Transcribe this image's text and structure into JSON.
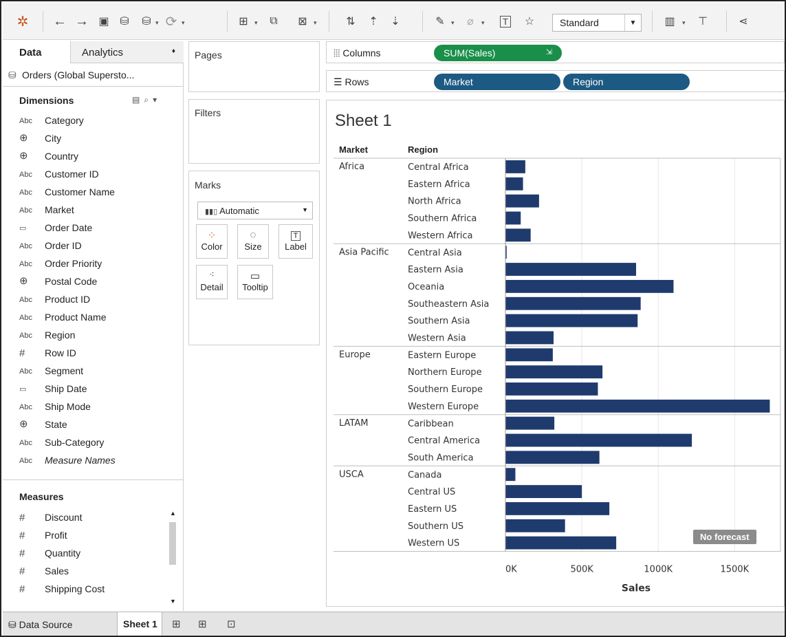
{
  "toolbar": {
    "icons": [
      "tableau-logo-icon",
      "back-icon",
      "forward-icon",
      "save-icon",
      "new-datasource-icon",
      "pause-updates-icon",
      "refresh-icon",
      "new-worksheet-icon",
      "duplicate-sheet-icon",
      "clear-sheet-icon",
      "swap-icon",
      "sort-asc-icon",
      "sort-desc-icon",
      "highlight-icon",
      "group-icon",
      "labels-icon",
      "pin-icon",
      "show-me-icon",
      "presentation-icon",
      "share-icon"
    ],
    "fit_value": "Standard"
  },
  "left": {
    "tabs": {
      "data": "Data",
      "analytics": "Analytics"
    },
    "datasource": "Orders (Global Supersto...",
    "dimensions_title": "Dimensions",
    "dimensions": [
      {
        "type": "Abc",
        "name": "Category"
      },
      {
        "type": "globe",
        "name": "City"
      },
      {
        "type": "globe",
        "name": "Country"
      },
      {
        "type": "Abc",
        "name": "Customer ID"
      },
      {
        "type": "Abc",
        "name": "Customer Name"
      },
      {
        "type": "Abc",
        "name": "Market"
      },
      {
        "type": "date",
        "name": "Order Date"
      },
      {
        "type": "Abc",
        "name": "Order ID"
      },
      {
        "type": "Abc",
        "name": "Order Priority"
      },
      {
        "type": "globe",
        "name": "Postal Code"
      },
      {
        "type": "Abc",
        "name": "Product ID"
      },
      {
        "type": "Abc",
        "name": "Product Name"
      },
      {
        "type": "Abc",
        "name": "Region"
      },
      {
        "type": "#",
        "name": "Row ID"
      },
      {
        "type": "Abc",
        "name": "Segment"
      },
      {
        "type": "date",
        "name": "Ship Date"
      },
      {
        "type": "Abc",
        "name": "Ship Mode"
      },
      {
        "type": "globe",
        "name": "State"
      },
      {
        "type": "Abc",
        "name": "Sub-Category"
      },
      {
        "type": "Abc",
        "name": "Measure Names",
        "italic": true
      }
    ],
    "measures_title": "Measures",
    "measures": [
      {
        "type": "#",
        "name": "Discount"
      },
      {
        "type": "#",
        "name": "Profit"
      },
      {
        "type": "#",
        "name": "Quantity"
      },
      {
        "type": "#",
        "name": "Sales"
      },
      {
        "type": "#",
        "name": "Shipping Cost"
      }
    ]
  },
  "cards": {
    "pages": "Pages",
    "filters": "Filters",
    "marks": "Marks",
    "mark_type": "Automatic",
    "mark_buttons": [
      "Color",
      "Size",
      "Label",
      "Detail",
      "Tooltip"
    ]
  },
  "shelves": {
    "columns_label": "Columns",
    "rows_label": "Rows",
    "columns_pills": [
      "SUM(Sales)"
    ],
    "rows_pills": [
      "Market",
      "Region"
    ]
  },
  "sheet": {
    "title": "Sheet 1",
    "market_header": "Market",
    "region_header": "Region",
    "no_forecast": "No forecast"
  },
  "chart_data": {
    "type": "bar",
    "orientation": "horizontal",
    "xlabel": "Sales",
    "xlim": [
      0,
      1800000
    ],
    "x_ticks": [
      "0K",
      "500K",
      "1000K",
      "1500K"
    ],
    "x_tick_values": [
      0,
      500000,
      1000000,
      1500000
    ],
    "bar_color": "#1f3b6e",
    "groups": [
      {
        "market": "Africa",
        "regions": [
          "Central Africa",
          "Eastern Africa",
          "North Africa",
          "Southern Africa",
          "Western Africa"
        ],
        "values": [
          130000,
          115000,
          220000,
          100000,
          165000
        ]
      },
      {
        "market": "Asia Pacific",
        "regions": [
          "Central Asia",
          "Eastern Asia",
          "Oceania",
          "Southeastern Asia",
          "Southern Asia",
          "Western Asia"
        ],
        "values": [
          8000,
          855000,
          1100000,
          885000,
          865000,
          315000
        ]
      },
      {
        "market": "Europe",
        "regions": [
          "Eastern Europe",
          "Northern Europe",
          "Southern Europe",
          "Western Europe"
        ],
        "values": [
          310000,
          635000,
          605000,
          1730000
        ]
      },
      {
        "market": "LATAM",
        "regions": [
          "Caribbean",
          "Central America",
          "South America"
        ],
        "values": [
          320000,
          1220000,
          615000
        ]
      },
      {
        "market": "USCA",
        "regions": [
          "Canada",
          "Central US",
          "Eastern US",
          "Southern US",
          "Western US"
        ],
        "values": [
          65000,
          500000,
          680000,
          390000,
          725000
        ]
      }
    ]
  },
  "bottom": {
    "datasource_tab": "Data Source",
    "sheet_tab": "Sheet 1"
  }
}
